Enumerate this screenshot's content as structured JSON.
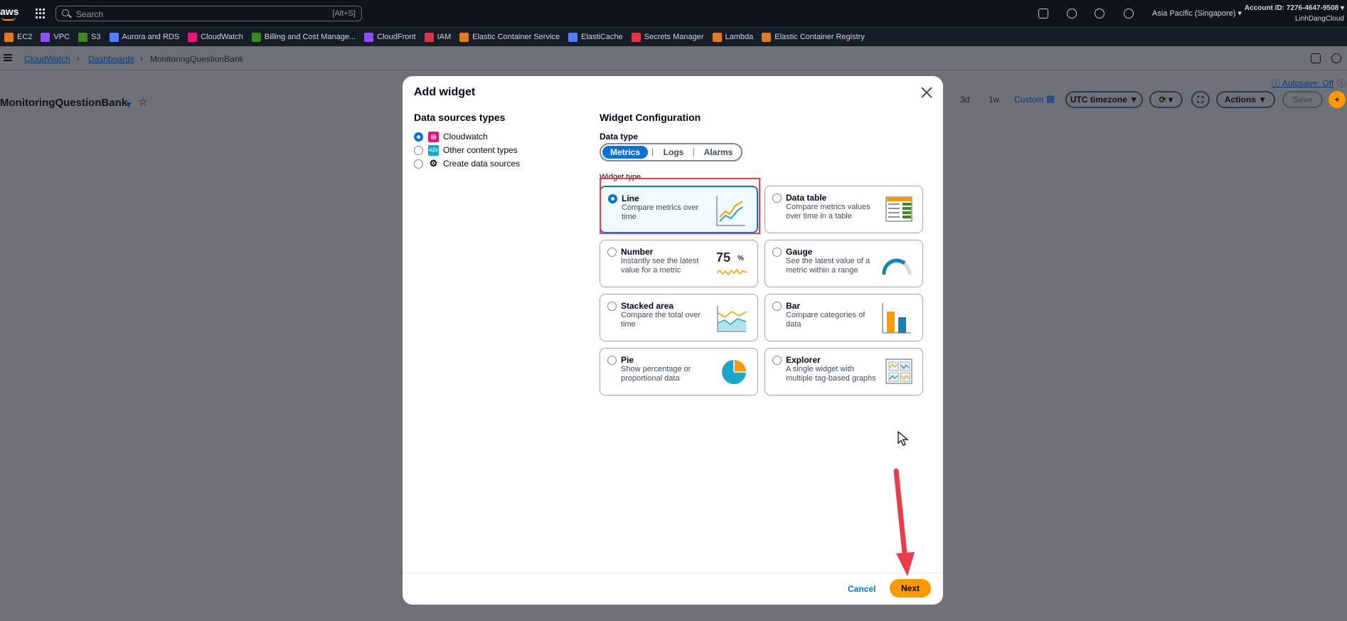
{
  "topnav": {
    "logo": "aws",
    "search_placeholder": "Search",
    "search_shortcut": "[Alt+S]",
    "region": "Asia Pacific (Singapore) ▾",
    "account_id": "Account ID: 7276-4647-9508 ▾",
    "account_name": "LinhDangCloud"
  },
  "favorites": [
    {
      "label": "EC2",
      "color": "#e07b24"
    },
    {
      "label": "VPC",
      "color": "#8c4fff"
    },
    {
      "label": "S3",
      "color": "#3f8624"
    },
    {
      "label": "Aurora and RDS",
      "color": "#527fff"
    },
    {
      "label": "CloudWatch",
      "color": "#e7157b"
    },
    {
      "label": "Billing and Cost Manage...",
      "color": "#3f8624"
    },
    {
      "label": "CloudFront",
      "color": "#8c4fff"
    },
    {
      "label": "IAM",
      "color": "#dd344c"
    },
    {
      "label": "Elastic Container Service",
      "color": "#e07b24"
    },
    {
      "label": "ElastiCache",
      "color": "#527fff"
    },
    {
      "label": "Secrets Manager",
      "color": "#dd344c"
    },
    {
      "label": "Lambda",
      "color": "#e07b24"
    },
    {
      "label": "Elastic Container Registry",
      "color": "#e07b24"
    }
  ],
  "breadcrumb": {
    "items": [
      "CloudWatch",
      "Dashboards",
      "MonitoringQuestionBank"
    ]
  },
  "page": {
    "dashboard_title": "MonitoringQuestionBank",
    "autosave": "Autosave: Off",
    "range_3d": "3d",
    "range_1w": "1w",
    "custom": "Custom",
    "timezone": "UTC timezone",
    "actions": "Actions",
    "save": "Save"
  },
  "modal": {
    "title": "Add widget",
    "data_sources_heading": "Data sources types",
    "data_sources": [
      {
        "label": "Cloudwatch",
        "selected": true
      },
      {
        "label": "Other content types",
        "selected": false
      },
      {
        "label": "Create data sources",
        "selected": false
      }
    ],
    "config_heading": "Widget Configuration",
    "data_type_label": "Data type",
    "data_types": [
      "Metrics",
      "Logs",
      "Alarms"
    ],
    "data_type_selected": "Metrics",
    "widget_type_label": "Widget type",
    "widget_types": [
      {
        "title": "Line",
        "desc": "Compare metrics over time",
        "selected": true
      },
      {
        "title": "Data table",
        "desc": "Compare metrics values over time in a table",
        "selected": false
      },
      {
        "title": "Number",
        "desc": "Instantly see the latest value for a metric",
        "selected": false,
        "preview_value": "75",
        "preview_unit": "%"
      },
      {
        "title": "Gauge",
        "desc": "See the latest value of a metric within a range",
        "selected": false
      },
      {
        "title": "Stacked area",
        "desc": "Compare the total over time",
        "selected": false
      },
      {
        "title": "Bar",
        "desc": "Compare categories of data",
        "selected": false
      },
      {
        "title": "Pie",
        "desc": "Show percentage or proportional data",
        "selected": false
      },
      {
        "title": "Explorer",
        "desc": "A single widget with multiple tag-based graphs",
        "selected": false
      }
    ],
    "cancel_label": "Cancel",
    "next_label": "Next"
  },
  "colors": {
    "accent": "#0972d3",
    "primary_button": "#ff9900",
    "highlight": "#e83e4b"
  }
}
